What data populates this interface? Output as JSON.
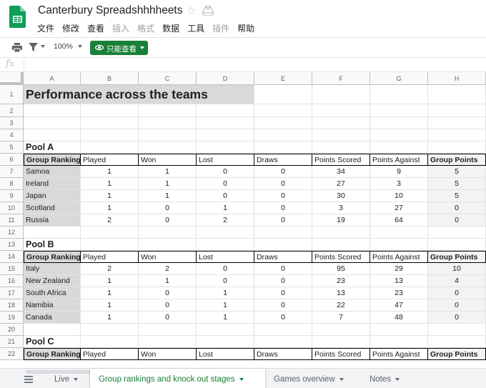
{
  "app": {
    "title": "Canterbury Spreadshhhheets",
    "menu": [
      {
        "label": "文件",
        "enabled": true
      },
      {
        "label": "修改",
        "enabled": true
      },
      {
        "label": "查看",
        "enabled": true
      },
      {
        "label": "插入",
        "enabled": false
      },
      {
        "label": "格式",
        "enabled": false
      },
      {
        "label": "数据",
        "enabled": true
      },
      {
        "label": "工具",
        "enabled": true
      },
      {
        "label": "插件",
        "enabled": false
      },
      {
        "label": "帮助",
        "enabled": true
      }
    ]
  },
  "toolbar": {
    "zoom": "100%",
    "view_only_label": "只能查看",
    "accent_color": "#188038"
  },
  "formula": {
    "fx_label": "fx"
  },
  "columns": [
    "A",
    "B",
    "C",
    "D",
    "E",
    "F",
    "G",
    "H"
  ],
  "rows": [
    "1",
    "2",
    "3",
    "4",
    "5",
    "6",
    "7",
    "8",
    "9",
    "10",
    "11",
    "12",
    "13",
    "14",
    "15",
    "16",
    "17",
    "18",
    "19",
    "20",
    "21",
    "22"
  ],
  "sheet": {
    "title": "Performance across the teams",
    "headers": [
      "Group Ranking",
      "Played",
      "Won",
      "Lost",
      "Draws",
      "Points Scored",
      "Points Against",
      "Group Points"
    ],
    "pools": [
      {
        "name": "Pool A",
        "teams": [
          [
            "Samoa",
            "1",
            "1",
            "0",
            "0",
            "34",
            "9",
            "5"
          ],
          [
            "Ireland",
            "1",
            "1",
            "0",
            "0",
            "27",
            "3",
            "5"
          ],
          [
            "Japan",
            "1",
            "1",
            "0",
            "0",
            "30",
            "10",
            "5"
          ],
          [
            "Scotland",
            "1",
            "0",
            "1",
            "0",
            "3",
            "27",
            "0"
          ],
          [
            "Russia",
            "2",
            "0",
            "2",
            "0",
            "19",
            "64",
            "0"
          ]
        ]
      },
      {
        "name": "Pool B",
        "teams": [
          [
            "Italy",
            "2",
            "2",
            "0",
            "0",
            "95",
            "29",
            "10"
          ],
          [
            "New Zealand",
            "1",
            "1",
            "0",
            "0",
            "23",
            "13",
            "4"
          ],
          [
            "South Africa",
            "1",
            "0",
            "1",
            "0",
            "13",
            "23",
            "0"
          ],
          [
            "Namibia",
            "1",
            "0",
            "1",
            "0",
            "22",
            "47",
            "0"
          ],
          [
            "Canada",
            "1",
            "0",
            "1",
            "0",
            "7",
            "48",
            "0"
          ]
        ]
      },
      {
        "name": "Pool C",
        "teams": []
      }
    ]
  },
  "tabs": [
    {
      "label": "Live",
      "active": false
    },
    {
      "label": "Group rankings and knock out stages",
      "active": true
    },
    {
      "label": "Games overview",
      "active": false
    },
    {
      "label": "Notes",
      "active": false
    }
  ]
}
